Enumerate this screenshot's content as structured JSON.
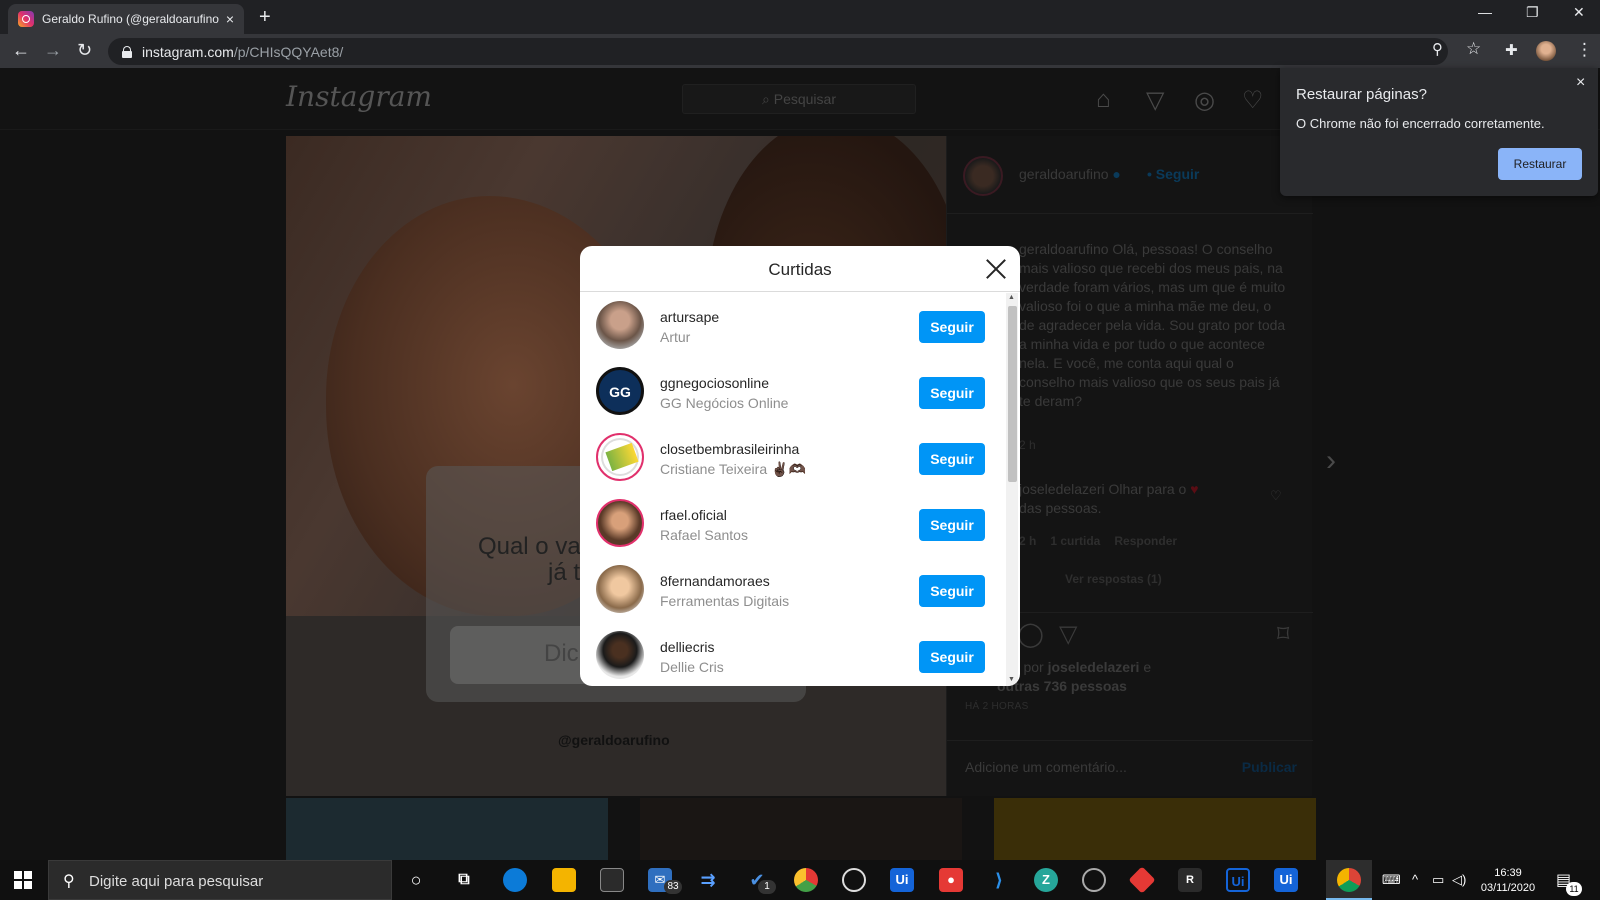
{
  "browser": {
    "tab_title": "Geraldo Rufino (@geraldoarufino",
    "tab_close": "×",
    "new_tab": "+",
    "url_host": "instagram.com",
    "url_path": "/p/CHIsQQYAet8/",
    "back": "←",
    "forward": "→",
    "reload": "↻",
    "minimize": "—",
    "restore_window": "❐",
    "close_window": "✕",
    "zoom_icon": "⚲",
    "star_icon": "☆",
    "extensions_icon": "✚",
    "menu_icon": "⋮"
  },
  "instagram": {
    "logo": "Instagram",
    "search_placeholder": "Pesquisar",
    "nav_icons": [
      "home-icon",
      "direct-icon",
      "explore-icon",
      "activity-icon"
    ],
    "post": {
      "question_text": "Qual o valioso d já t",
      "input_text": "Dic",
      "handle": "@geraldoarufino",
      "author": "geraldoarufino",
      "follow_label": "• Seguir",
      "caption_author": "geraldoarufino",
      "caption_text": "Olá, pessoas! O conselho mais valioso que recebi dos meus pais, na verdade foram vários, mas um que é muito valioso foi o que a minha mãe me deu, o de agradecer pela vida. Sou grato por toda a minha vida e por tudo o que acontece nela. E você, me conta aqui qual o conselho mais valioso que os seus pais já te deram?",
      "caption_time": "2 h",
      "comment_author": "joseledelazeri",
      "comment_text": "Olhar para o",
      "comment_text_2": "das pessoas.",
      "comment_time": "2 h",
      "comment_likes": "1 curtida",
      "comment_reply": "Responder",
      "view_replies": "Ver respostas (1)",
      "liked_by_prefix": "tido por",
      "liked_by_user": "joseledelazeri",
      "liked_by_suffix": "e",
      "liked_by_others": "outras 736 pessoas",
      "ago": "HÁ 2 HORAS",
      "add_comment_placeholder": "Adicione um comentário...",
      "publish_label": "Publicar"
    }
  },
  "likes_modal": {
    "title": "Curtidas",
    "follow_label": "Seguir",
    "likers": [
      {
        "username": "artursape",
        "fullname": "Artur"
      },
      {
        "username": "ggnegociosonline",
        "fullname": "GG Negócios Online",
        "avatar_text": "GG"
      },
      {
        "username": "closetbembrasileirinha",
        "fullname": "Cristiane Teixeira ✌🏿🫶🏿"
      },
      {
        "username": "rfael.oficial",
        "fullname": "Rafael Santos"
      },
      {
        "username": "8fernandamoraes",
        "fullname": "Ferramentas Digitais"
      },
      {
        "username": "delliecris",
        "fullname": "Dellie Cris"
      }
    ]
  },
  "restore_popup": {
    "title": "Restaurar páginas?",
    "message": "O Chrome não foi encerrado corretamente.",
    "button": "Restaurar",
    "close": "×"
  },
  "taskbar": {
    "search_placeholder": "Digite aqui para pesquisar",
    "mail_badge": "83",
    "todo_badge": "1",
    "apps": [
      "cortana-icon",
      "task-view-icon",
      "edge-icon",
      "file-explorer-icon",
      "store-icon",
      "mail-icon",
      "azure-devops-icon",
      "todo-icon",
      "shield-app-icon",
      "obs-icon",
      "uipath-icon",
      "cast-icon",
      "vscode-icon",
      "zoom-icon",
      "camera-app-icon",
      "anydesk-icon",
      "r-app-icon",
      "uipath-studio-icon",
      "uipath-icon-2",
      "chrome-icon"
    ],
    "time": "16:39",
    "date": "03/11/2020",
    "notification_count": "11"
  },
  "colors": {
    "follow_blue": "#0095f6",
    "chrome_dark": "#202124",
    "restore_button": "#8ab4f8"
  }
}
